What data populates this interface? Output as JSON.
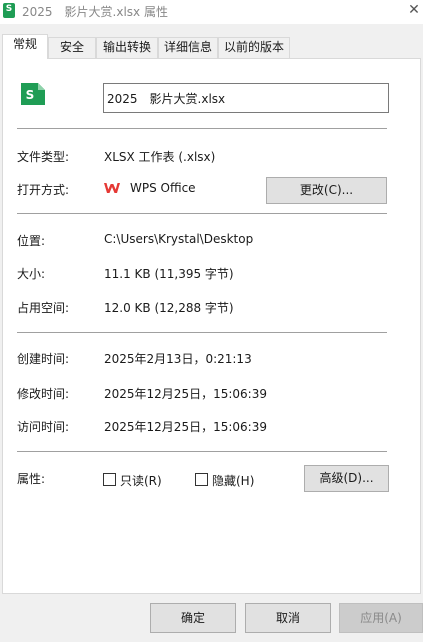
{
  "window": {
    "title": "2025　影片大赏.xlsx 属性",
    "close_glyph": "✕"
  },
  "tabs": [
    {
      "label": "常规"
    },
    {
      "label": "安全"
    },
    {
      "label": "输出转换"
    },
    {
      "label": "详细信息"
    },
    {
      "label": "以前的版本"
    }
  ],
  "general": {
    "filename": "2025　影片大赏.xlsx",
    "file_type_label": "文件类型:",
    "file_type_value": "XLSX 工作表 (.xlsx)",
    "open_with_label": "打开方式:",
    "open_with_value": "WPS Office",
    "change_button": "更改(C)...",
    "location_label": "位置:",
    "location_value": "C:\\Users\\Krystal\\Desktop",
    "size_label": "大小:",
    "size_value": "11.1 KB (11,395 字节)",
    "disk_size_label": "占用空间:",
    "disk_size_value": "12.0 KB (12,288 字节)",
    "created_label": "创建时间:",
    "created_value": "2025年2月13日，0:21:13",
    "modified_label": "修改时间:",
    "modified_value": "2025年12月25日，15:06:39",
    "accessed_label": "访问时间:",
    "accessed_value": "2025年12月25日，15:06:39",
    "attributes_label": "属性:",
    "readonly_label": "只读(R)",
    "readonly_checked": false,
    "hidden_label": "隐藏(H)",
    "hidden_checked": false,
    "advanced_button": "高级(D)..."
  },
  "footer": {
    "ok": "确定",
    "cancel": "取消",
    "apply": "应用(A)"
  },
  "colors": {
    "wps_red": "#e53935",
    "xlsx_green": "#1f9d55"
  }
}
